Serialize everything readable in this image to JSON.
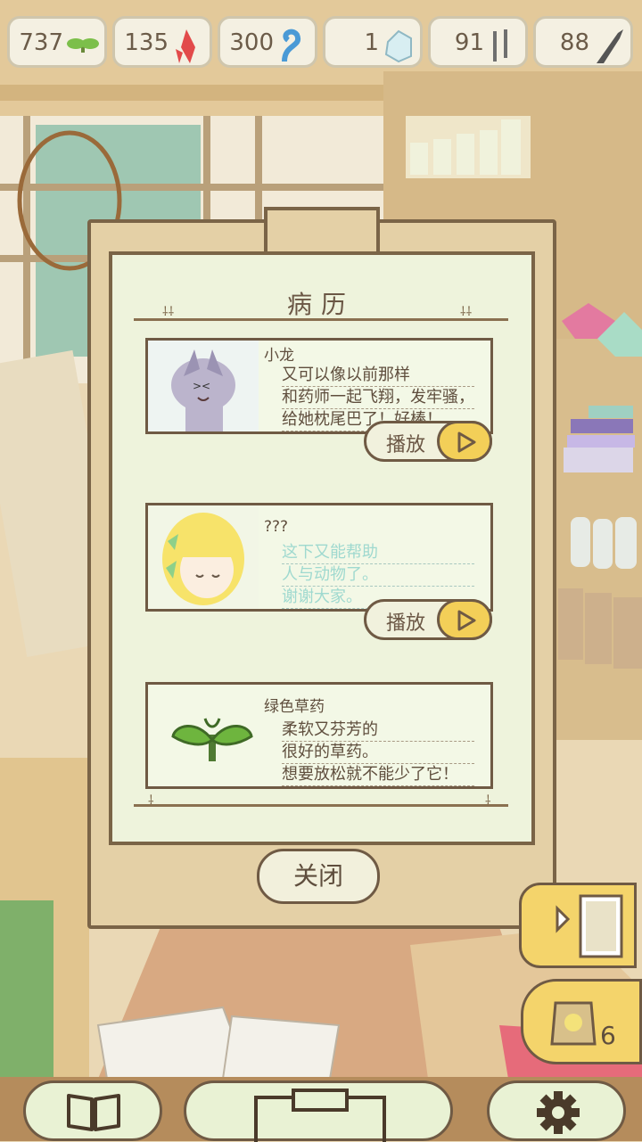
{
  "resources": [
    {
      "value": "737",
      "icon": "leaf-icon"
    },
    {
      "value": "135",
      "icon": "red-crystal-icon"
    },
    {
      "value": "300",
      "icon": "blue-wave-icon"
    },
    {
      "value": "1",
      "icon": "ice-crystal-icon"
    },
    {
      "value": "91",
      "icon": "claw-icon"
    },
    {
      "value": "88",
      "icon": "horn-icon"
    }
  ],
  "dialog": {
    "title": "病历",
    "entries": [
      {
        "name": "小龙",
        "lines": [
          "又可以像以前那样",
          "和药师一起飞翔，发牢骚，",
          "给她枕尾巴了！好棒！"
        ],
        "play_label": "播放",
        "portrait": "dragon-portrait"
      },
      {
        "name": "???",
        "lines": [
          "这下又能帮助",
          "人与动物了。",
          "谢谢大家。"
        ],
        "play_label": "播放",
        "portrait": "girl-portrait"
      },
      {
        "name": "绿色草药",
        "lines": [
          "柔软又芬芳的",
          "很好的草药。",
          "想要放松就不能少了它！"
        ],
        "portrait": "green-herb-icon"
      }
    ],
    "close_label": "关闭"
  },
  "side_buttons": {
    "bag_count": "6"
  },
  "colors": {
    "accent_yellow": "#f4d46b",
    "sheet_bg": "#eef3dc",
    "frame_brown": "#6f5a44"
  }
}
